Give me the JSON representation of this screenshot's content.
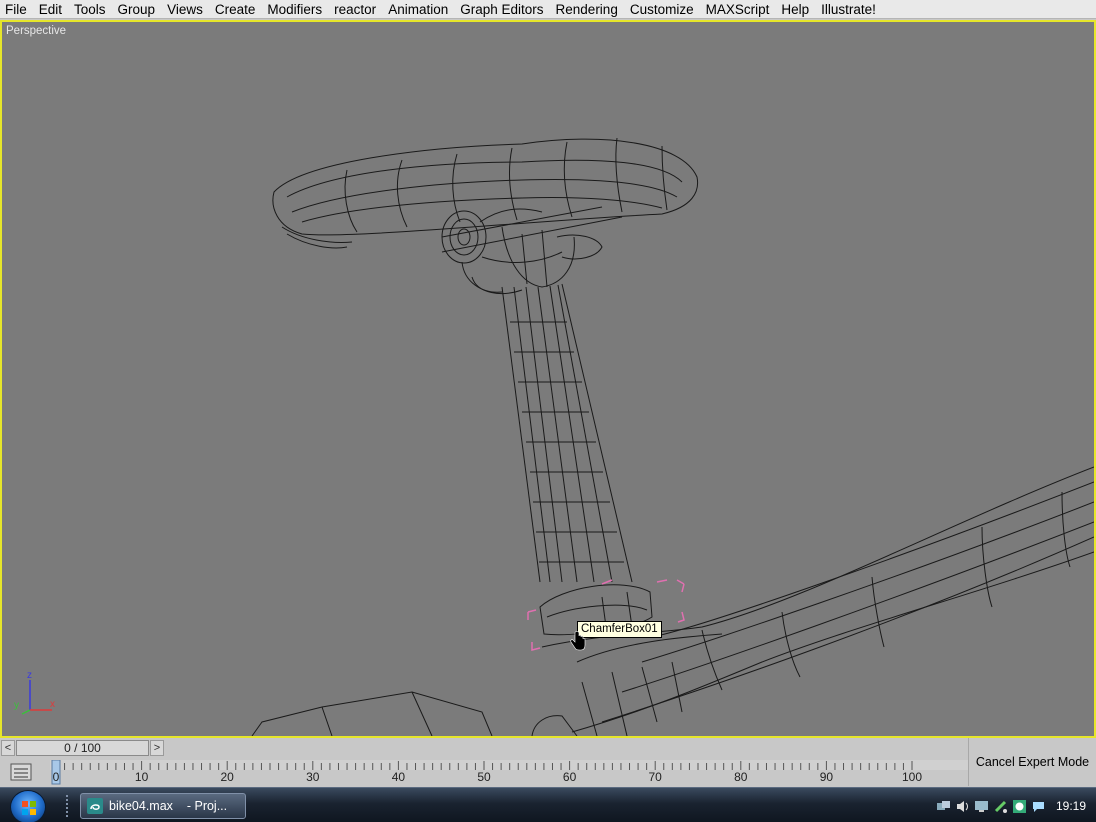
{
  "menubar": {
    "items": [
      "File",
      "Edit",
      "Tools",
      "Group",
      "Views",
      "Create",
      "Modifiers",
      "reactor",
      "Animation",
      "Graph Editors",
      "Rendering",
      "Customize",
      "MAXScript",
      "Help",
      "Illustrate!"
    ]
  },
  "viewport": {
    "label": "Perspective",
    "tooltip": "ChamferBox01",
    "border_color": "#e6e62a",
    "background": "#7b7b7b",
    "axes": {
      "z": "z",
      "y": "y",
      "x": "x"
    }
  },
  "timeline": {
    "prev_label": "<",
    "next_label": ">",
    "frame_display": "0 / 100",
    "ruler_labels": [
      "0",
      "10",
      "20",
      "30",
      "40",
      "50",
      "60",
      "70",
      "80",
      "90",
      "100"
    ]
  },
  "expert_mode": {
    "label": "Cancel Expert Mode"
  },
  "taskbar": {
    "task_file": "bike04.max",
    "task_rest": "- Proj...",
    "clock": "19:19"
  }
}
